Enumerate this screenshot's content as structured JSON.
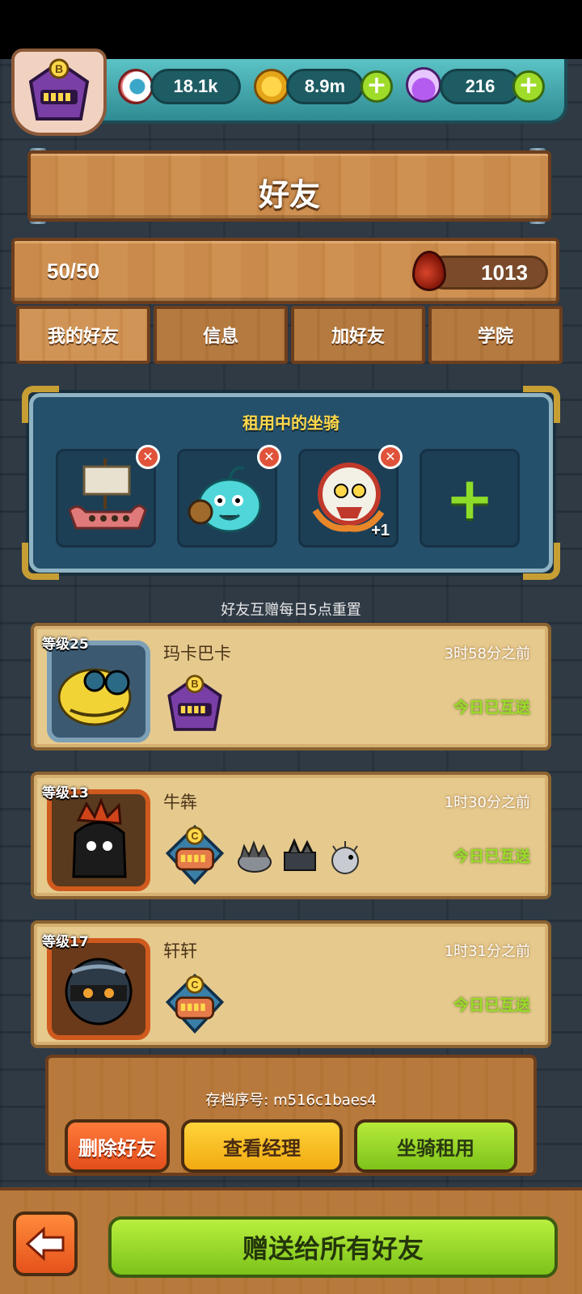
{
  "resources": {
    "eyeballs": "18.1k",
    "coins": "8.9m",
    "potions": "216"
  },
  "header": {
    "title": "好友"
  },
  "info": {
    "friend_count": "50/50",
    "blood": "1013"
  },
  "tabs": [
    {
      "label": "我的好友",
      "active": true
    },
    {
      "label": "信息",
      "active": false
    },
    {
      "label": "加好友",
      "active": false
    },
    {
      "label": "学院",
      "active": false
    }
  ],
  "mounts": {
    "title": "租用中的坐骑",
    "slot3_extra": "+1"
  },
  "reset_note": "好友互赠每日5点重置",
  "friends": [
    {
      "level": "等级25",
      "name": "玛卡巴卡",
      "time": "3时58分之前",
      "status": "今日已互送",
      "rank": "B"
    },
    {
      "level": "等级13",
      "name": "牛犇",
      "time": "1时30分之前",
      "status": "今日已互送",
      "rank": "C"
    },
    {
      "level": "等级17",
      "name": "轩轩",
      "time": "1时31分之前",
      "status": "今日已互送",
      "rank": "C"
    }
  ],
  "footer": {
    "save_id": "存档序号: m516c1baes4",
    "delete_label": "删除好友",
    "view_label": "查看经理",
    "rent_label": "坐骑租用",
    "gift_all_label": "赠送给所有好友"
  },
  "icons": {
    "eyeball": "eyeball-icon",
    "coin": "coin-icon",
    "potion": "potion-icon",
    "blood": "blood-drop-icon",
    "back": "back-arrow-icon"
  },
  "colors": {
    "wood": "#c98a4b",
    "panel_blue": "#25506b",
    "accent_green": "#9bdc29",
    "gold_title": "#ffd84a"
  }
}
